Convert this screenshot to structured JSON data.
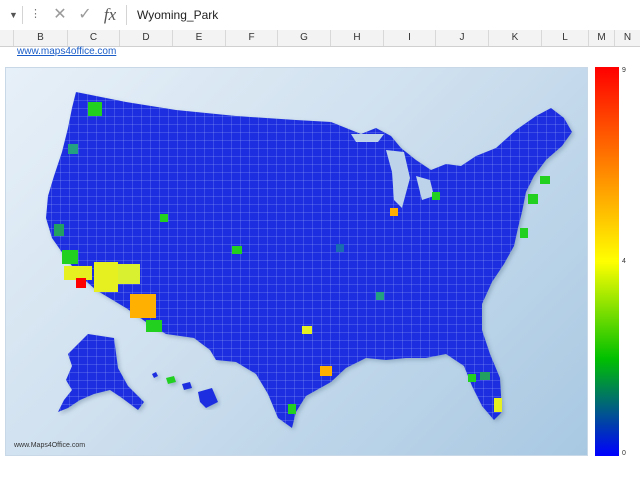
{
  "formula_bar": {
    "kebab": "⋮",
    "cancel_icon": "close-icon",
    "enter_icon": "check-icon",
    "function_label": "fx",
    "content": "Wyoming_Park"
  },
  "columns": [
    {
      "label": "B"
    },
    {
      "label": "C"
    },
    {
      "label": "D"
    },
    {
      "label": "E"
    },
    {
      "label": "F"
    },
    {
      "label": "G"
    },
    {
      "label": "H"
    },
    {
      "label": "I"
    },
    {
      "label": "J"
    },
    {
      "label": "K"
    },
    {
      "label": "L"
    },
    {
      "label": "M"
    },
    {
      "label": "N"
    }
  ],
  "sheet": {
    "link_text": "www.maps4office.com"
  },
  "map": {
    "watermark": "www.Maps4Office.com",
    "colors": {
      "land": "#1d2fe0",
      "border": "#c8d6ff",
      "highlight_red": "#ff0000",
      "highlight_yellow": "#e6f020",
      "highlight_green": "#22d020",
      "highlight_orange": "#ffb000"
    }
  },
  "legend": {
    "max_label": "9",
    "mid_label": "4",
    "min_label": "0"
  }
}
